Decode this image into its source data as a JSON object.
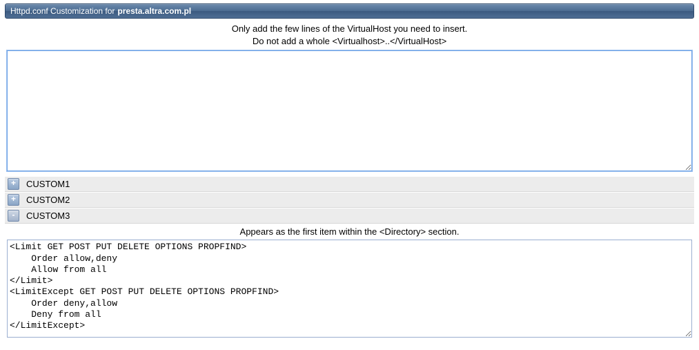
{
  "titleBar": {
    "prefix": "Httpd.conf Customization for",
    "host": "presta.altra.com.pl"
  },
  "topInstructions": {
    "line1": "Only add the few lines of the VirtualHost you need to insert.",
    "line2": "Do not add a whole <Virtualhost>..</VirtualHost>"
  },
  "topTextareaValue": "",
  "sections": [
    {
      "toggle": "+",
      "label": "CUSTOM1",
      "expanded": false
    },
    {
      "toggle": "+",
      "label": "CUSTOM2",
      "expanded": false
    },
    {
      "toggle": "-",
      "label": "CUSTOM3",
      "expanded": true,
      "description": "Appears as the first item within the <Directory> section.",
      "textareaValue": "<Limit GET POST PUT DELETE OPTIONS PROPFIND>\n    Order allow,deny\n    Allow from all\n</Limit>\n<LimitExcept GET POST PUT DELETE OPTIONS PROPFIND>\n    Order deny,allow\n    Deny from all\n</LimitExcept>"
    }
  ]
}
